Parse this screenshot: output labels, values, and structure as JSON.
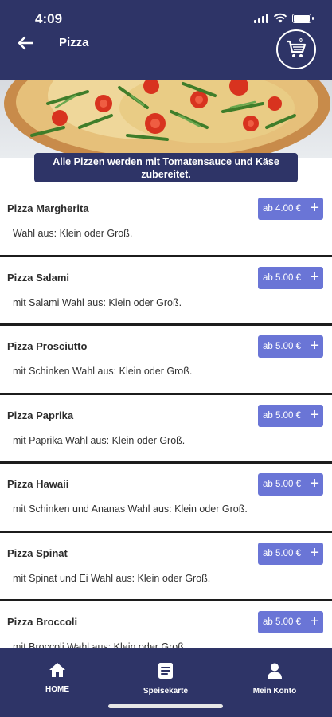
{
  "status_bar": {
    "time": "4:09"
  },
  "header": {
    "title": "Pizza",
    "cart_count": "0"
  },
  "hero": {
    "caption": "Alle Pizzen werden mit Tomatensauce und Käse zubereitet."
  },
  "menu_items": [
    {
      "name": "Pizza Margherita",
      "price": "ab 4.00 €",
      "description": "Wahl aus: Klein oder Groß."
    },
    {
      "name": "Pizza Salami",
      "price": "ab 5.00 €",
      "description": "mit Salami Wahl aus: Klein oder Groß."
    },
    {
      "name": "Pizza Prosciutto",
      "price": "ab 5.00 €",
      "description": "mit Schinken Wahl aus: Klein oder Groß."
    },
    {
      "name": "Pizza Paprika",
      "price": "ab 5.00 €",
      "description": "mit Paprika Wahl aus: Klein oder Groß."
    },
    {
      "name": "Pizza Hawaii",
      "price": "ab 5.00 €",
      "description": "mit Schinken und Ananas Wahl aus: Klein oder Groß."
    },
    {
      "name": "Pizza Spinat",
      "price": "ab 5.00 €",
      "description": "mit Spinat und Ei Wahl aus: Klein oder Groß."
    },
    {
      "name": "Pizza Broccoli",
      "price": "ab 5.00 €",
      "description": "mit Broccoli Wahl aus: Klein oder Groß."
    }
  ],
  "bottom_nav": {
    "home": "HOME",
    "menu": "Speisekarte",
    "account": "Mein Konto"
  },
  "colors": {
    "primary": "#2e3467",
    "accent": "#6a75d6"
  }
}
